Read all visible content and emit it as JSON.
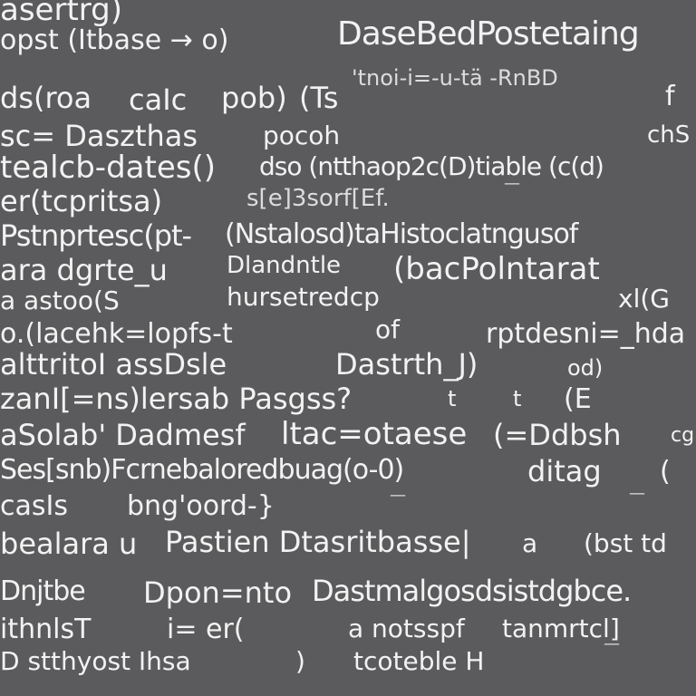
{
  "lines": [
    "asertrg)",
    "opst (Itbase → o)",
    "DaseBedPostetaing",
    "'tnoi-i=-u-tä -RnBD",
    "ds(roa",
    "caIc",
    "pob)",
    "(Ts",
    "f",
    "sc= Daszthas",
    "pocoh",
    "chS",
    "tealcb-dates()",
    "dso (ntthaop2c(D)tiable (c(d)",
    "er(tcpritsa)",
    "s[e]3sorf[Ef.",
    "Pstnprtesc(pt-",
    "(Nstalosd)taHistoclatngusof",
    "ara dgrte_u",
    "Dlandntle",
    "(bacPolntarat",
    "a astoo(S",
    "hursetredcp",
    "xl(G",
    "o.(lacehk=lopfs-t",
    "of",
    "rptdesni=_hda",
    "alttritoI assDsle",
    "Dastrth_J)",
    "od)",
    "zanI[=ns)lersab Pasgss?",
    "t",
    "t",
    "(E",
    "aSolab' Dadmesf",
    "ltac=otaese",
    "(=Ddbsh",
    "cg",
    "Ses[snb)Fcrnebaloredbuag(o-0)",
    "ditag",
    "(",
    "casIs",
    "bng'oord-}",
    "bealara u",
    "Pastien Dtasritbasse|",
    "a",
    "(bst td",
    "Dnjtbe",
    "Dpon=nto",
    "Dastmalgosdsistdgbce.",
    "ithnlsT",
    "i= er(",
    "a notsspf",
    "tanmrtcl]",
    "D stthyost Ihsa",
    ")",
    "tcoteble H"
  ]
}
